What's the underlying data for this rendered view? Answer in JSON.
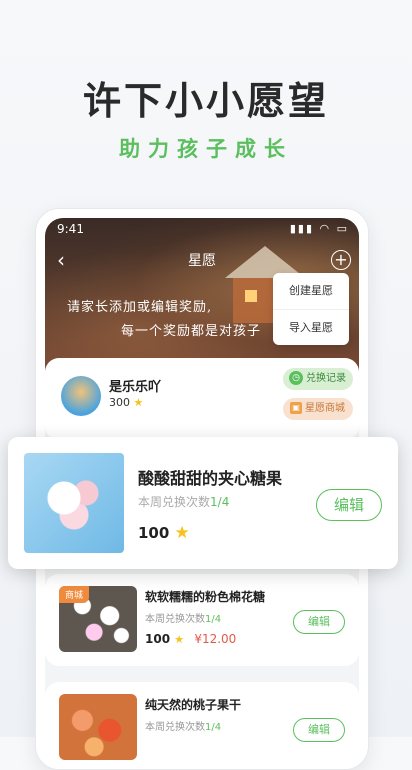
{
  "promo": {
    "title": "许下小小愿望",
    "subtitle": "助力孩子成长"
  },
  "status_bar": {
    "time": "9:41"
  },
  "nav": {
    "title": "星愿",
    "back_icon": "chevron-left-icon",
    "add_icon": "plus-circle-icon"
  },
  "hero": {
    "line1": "请家长添加或编辑奖励,",
    "line2": "每一个奖励都是对孩子"
  },
  "menu": {
    "items": [
      "创建星愿",
      "导入星愿"
    ]
  },
  "profile": {
    "name": "是乐乐吖",
    "points": "300",
    "records_label": "兑换记录",
    "mall_label": "星愿商城"
  },
  "featured": {
    "name": "酸酸甜甜的夹心糖果",
    "count_label": "本周兑换次数",
    "count_value": "1/4",
    "points": "100",
    "edit_label": "编辑"
  },
  "items": [
    {
      "tag": "商城",
      "name": "软软糯糯的粉色棉花糖",
      "count_label": "本周兑换次数",
      "count_value": "1/4",
      "points": "100",
      "price": "¥12.00",
      "edit_label": "编辑"
    },
    {
      "name": "纯天然的桃子果干",
      "count_label": "本周兑换次数",
      "count_value": "1/4",
      "edit_label": "编辑"
    }
  ],
  "colors": {
    "accent": "#5bbf5e",
    "star": "#f6c21b",
    "price": "#e25a4a"
  }
}
